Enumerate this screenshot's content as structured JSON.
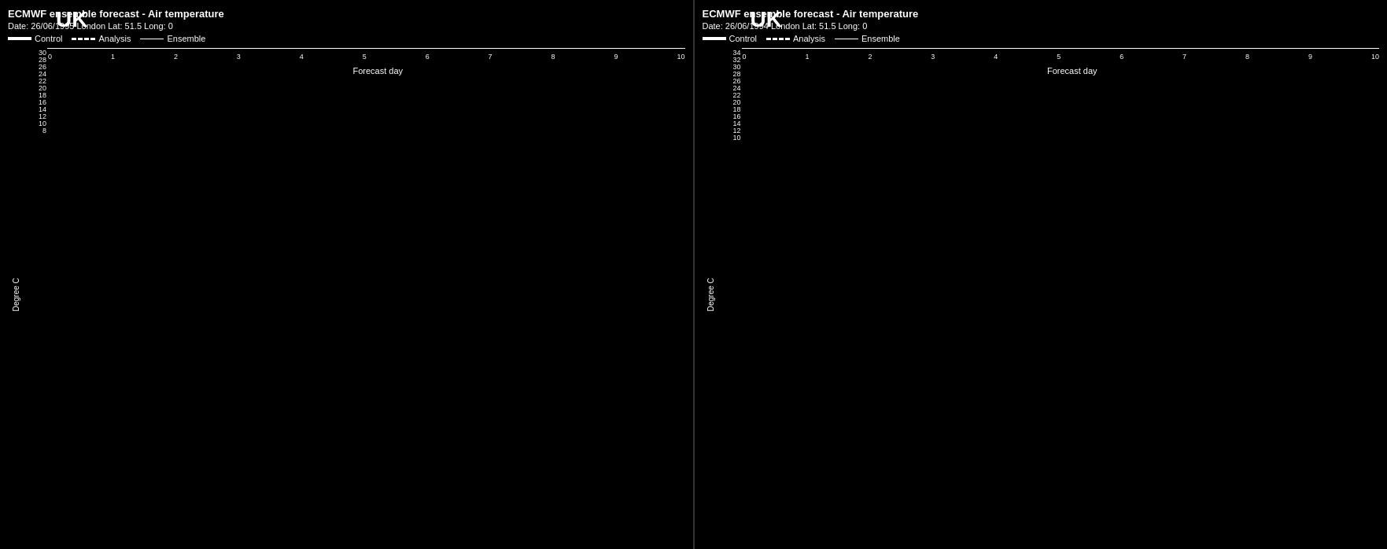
{
  "left_chart": {
    "title": "ECMWF ensemble forecast -    Air temperature",
    "subtitle": "Date: 26/06/1995  London  Lat: 51.5  Long: 0",
    "legend": {
      "control": "Control",
      "analysis": "Analysis",
      "ensemble": "Ensemble"
    },
    "y_axis_label": "Degree C",
    "x_axis_label": "Forecast day",
    "uk_label": "UK",
    "y_ticks": [
      "30",
      "28",
      "26",
      "24",
      "22",
      "20",
      "18",
      "16",
      "14",
      "12",
      "10",
      "8"
    ],
    "x_ticks": [
      "0",
      "1",
      "2",
      "3",
      "4",
      "5",
      "6",
      "7",
      "8",
      "9",
      "10"
    ]
  },
  "right_chart": {
    "title": "ECMWF ensemble forecast -    Air temperature",
    "subtitle": "Date: 26/06/1994  London  Lat: 51.5  Long: 0",
    "legend": {
      "control": "Control",
      "analysis": "Analysis",
      "ensemble": "Ensemble"
    },
    "y_axis_label": "Degree C",
    "x_axis_label": "Forecast day",
    "uk_label": "UK",
    "y_ticks": [
      "34",
      "32",
      "30",
      "28",
      "26",
      "24",
      "22",
      "20",
      "18",
      "16",
      "14",
      "12",
      "10"
    ],
    "x_ticks": [
      "0",
      "1",
      "2",
      "3",
      "4",
      "5",
      "6",
      "7",
      "8",
      "9",
      "10"
    ]
  }
}
